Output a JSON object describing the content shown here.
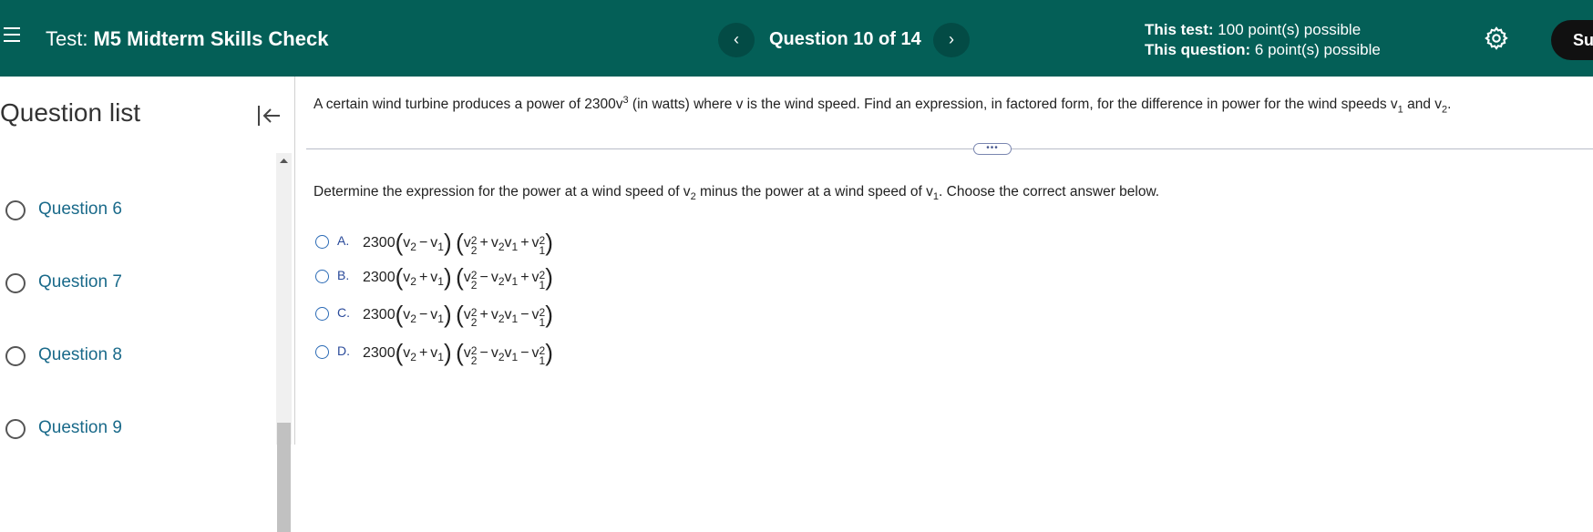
{
  "header": {
    "test_prefix": "Test:",
    "test_name": "M5 Midterm Skills Check",
    "question_counter": "Question 10 of 14",
    "prev_label": "‹",
    "next_label": "›",
    "test_points_label": "This test:",
    "test_points_value": "100 point(s) possible",
    "question_points_label": "This question:",
    "question_points_value": "6 point(s) possible",
    "submit_label": "Su",
    "icons": [
      "menu-icon",
      "chevron-left-icon",
      "chevron-right-icon",
      "gear-icon"
    ]
  },
  "sidebar": {
    "title": "Question list",
    "collapse_icon": "collapse-left-icon",
    "items": [
      {
        "label": "Question 6"
      },
      {
        "label": "Question 7"
      },
      {
        "label": "Question 8"
      },
      {
        "label": "Question 9"
      }
    ]
  },
  "question": {
    "text_part1": "A certain wind turbine produces a power of 2300v",
    "text_exp": "3",
    "text_part2": " (in watts) where v is the wind speed. Find an expression, in factored form, for the difference in power for the wind speeds v",
    "text_sub1": "1",
    "text_part3": " and v",
    "text_sub2": "2",
    "text_part4": ".",
    "divider_handle": "•••",
    "instruction_part1": "Determine the expression for the power at a wind speed of v",
    "instruction_sub2": "2",
    "instruction_part2": " minus the power at a wind speed of v",
    "instruction_sub1": "1",
    "instruction_part3": ". Choose the correct answer below."
  },
  "choices": [
    {
      "letter": "A.",
      "coef": "2300",
      "op1": "−",
      "op2": "+",
      "op3": "+"
    },
    {
      "letter": "B.",
      "coef": "2300",
      "op1": "+",
      "op2": "−",
      "op3": "+"
    },
    {
      "letter": "C.",
      "coef": "2300",
      "op1": "−",
      "op2": "+",
      "op3": "−"
    },
    {
      "letter": "D.",
      "coef": "2300",
      "op1": "+",
      "op2": "−",
      "op3": "−"
    }
  ],
  "colors": {
    "header_bg": "#045f57",
    "link": "#1a6a8a",
    "choice_letter": "#2a4a9a"
  }
}
